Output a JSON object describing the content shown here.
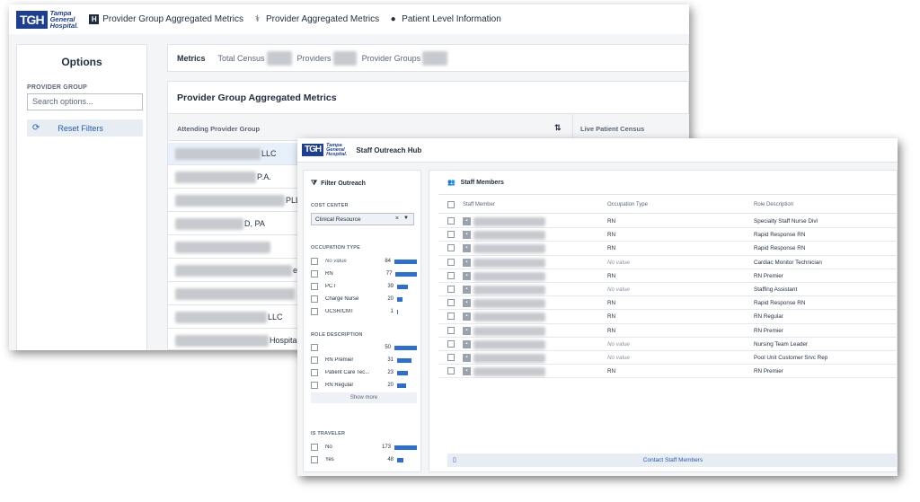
{
  "back": {
    "logo_mark": "TGH",
    "logo_text": [
      "Tampa",
      "General",
      "Hospital."
    ],
    "nav": [
      {
        "label": "Provider Group Aggregated Metrics",
        "icon": "h-square-icon"
      },
      {
        "label": "Provider Aggregated Metrics",
        "icon": "stethoscope-icon"
      },
      {
        "label": "Patient Level Information",
        "icon": "person-icon"
      }
    ],
    "options": {
      "title": "Options",
      "group_label": "PROVIDER GROUP",
      "search_placeholder": "Search options...",
      "reset_label": "Reset Filters"
    },
    "metrics": {
      "metrics_label": "Metrics",
      "total_census": "Total Census",
      "providers": "Providers",
      "provider_groups": "Provider Groups"
    },
    "card": {
      "title": "Provider Group Aggregated Metrics",
      "col1": "Attending Provider Group",
      "col2": "Live Patient Census",
      "sort_icon": "sort-az-icon",
      "rows": [
        {
          "suffix": "LLC"
        },
        {
          "suffix": "P.A."
        },
        {
          "suffix": "PLL"
        },
        {
          "suffix": "D, PA"
        },
        {
          "suffix": ""
        },
        {
          "suffix": "e"
        },
        {
          "suffix": ""
        },
        {
          "suffix": "LLC"
        },
        {
          "suffix": "Hospital"
        }
      ]
    }
  },
  "front": {
    "logo_mark": "TGH",
    "logo_text": [
      "Tampa",
      "General",
      "Hospital."
    ],
    "title": "Staff Outreach Hub",
    "filter": {
      "title": "Filter Outreach",
      "cost_center_label": "COST CENTER",
      "cost_center_value": "Clinical Resource",
      "occupation_label": "OCCUPATION TYPE",
      "occupation": [
        {
          "label": "No value",
          "count": "84",
          "value": 84
        },
        {
          "label": "RN",
          "count": "77",
          "value": 77
        },
        {
          "label": "PCT",
          "count": "39",
          "value": 39
        },
        {
          "label": "Charge Nurse",
          "count": "20",
          "value": 20
        },
        {
          "label": "UCSR/CMT",
          "count": "1",
          "value": 1
        }
      ],
      "role_label": "ROLE DESCRIPTION",
      "roles": [
        {
          "label": "",
          "count": "50",
          "value": 50
        },
        {
          "label": "RN Premier",
          "count": "31",
          "value": 31
        },
        {
          "label": "Patient Care Tec...",
          "count": "23",
          "value": 23
        },
        {
          "label": "RN Regular",
          "count": "20",
          "value": 20
        }
      ],
      "show_more": "Show more",
      "traveler_label": "IS TRAVELER",
      "traveler": [
        {
          "label": "No",
          "count": "173",
          "value": 173
        },
        {
          "label": "Yes",
          "count": "48",
          "value": 48
        }
      ]
    },
    "staff": {
      "title": "Staff Members",
      "col_member": "Staff Member",
      "col_occupation": "Occupation Type",
      "col_role": "Role Description",
      "rows": [
        {
          "occupation": "RN",
          "role": "Specialty Staff Nurse Divl"
        },
        {
          "occupation": "RN",
          "role": "Rapid Response RN"
        },
        {
          "occupation": "RN",
          "role": "Rapid Response RN"
        },
        {
          "occupation": "No value",
          "role": "Cardiac Monitor Technician"
        },
        {
          "occupation": "RN",
          "role": "RN Premier"
        },
        {
          "occupation": "No value",
          "role": "Staffing Assistant"
        },
        {
          "occupation": "RN",
          "role": "Rapid Response RN"
        },
        {
          "occupation": "RN",
          "role": "RN Regular"
        },
        {
          "occupation": "RN",
          "role": "RN Premier"
        },
        {
          "occupation": "No value",
          "role": "Nursing Team Leader"
        },
        {
          "occupation": "No value",
          "role": "Pool Unit Customer Srvc Rep"
        },
        {
          "occupation": "RN",
          "role": "RN Premier"
        }
      ],
      "contact_label": "Contact Staff Members"
    }
  }
}
